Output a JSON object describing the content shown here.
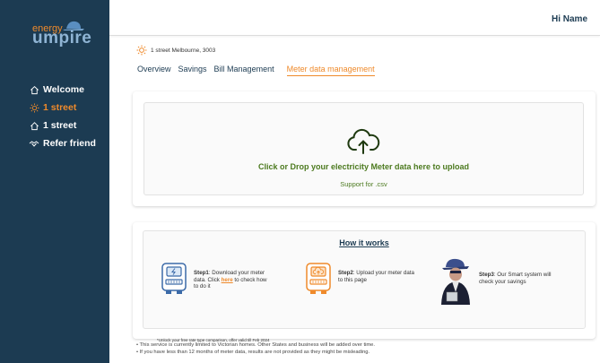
{
  "brand": {
    "small": "energy",
    "big": "umpire"
  },
  "sidebar": {
    "items": [
      {
        "label": "Welcome",
        "icon": "home-icon",
        "active": false
      },
      {
        "label": "1 street",
        "icon": "sun-icon",
        "active": true
      },
      {
        "label": "1 street",
        "icon": "house-icon",
        "active": false
      },
      {
        "label": "Refer friend",
        "icon": "handshake-icon",
        "active": false
      }
    ]
  },
  "header": {
    "greeting": "Hi  Name"
  },
  "address": "1 street Melbourne, 3003",
  "tabs": [
    "Overview",
    "Savings",
    "Bill Management",
    "Meter data management"
  ],
  "upload": {
    "title": "Click or Drop your electricity Meter data here to upload",
    "subtitle": "Support for .csv"
  },
  "how": {
    "title": "How it works",
    "step1": {
      "bold": "Step1",
      "pre": ": Download your meter data. Click ",
      "link": "here",
      "post": " to check how to do it"
    },
    "step2": {
      "bold": "Step2",
      "text": ": Upload  your meter data to this page"
    },
    "step3": {
      "bold": "Step3",
      "text": ": Our Smart system will check your savings"
    },
    "offer": "*Unlock your free rate type comparison, offer valid till Feb 2024"
  },
  "notes": [
    "• This service is currently limited to Victorian homes. Other States and business will be added over time.",
    "• If you have less than 12 months of meter data, results are not provided as they might be misleading."
  ],
  "colors": {
    "sidebar": "#1c3b52",
    "accent": "#ef8a2b",
    "green": "#4c7a1f"
  }
}
